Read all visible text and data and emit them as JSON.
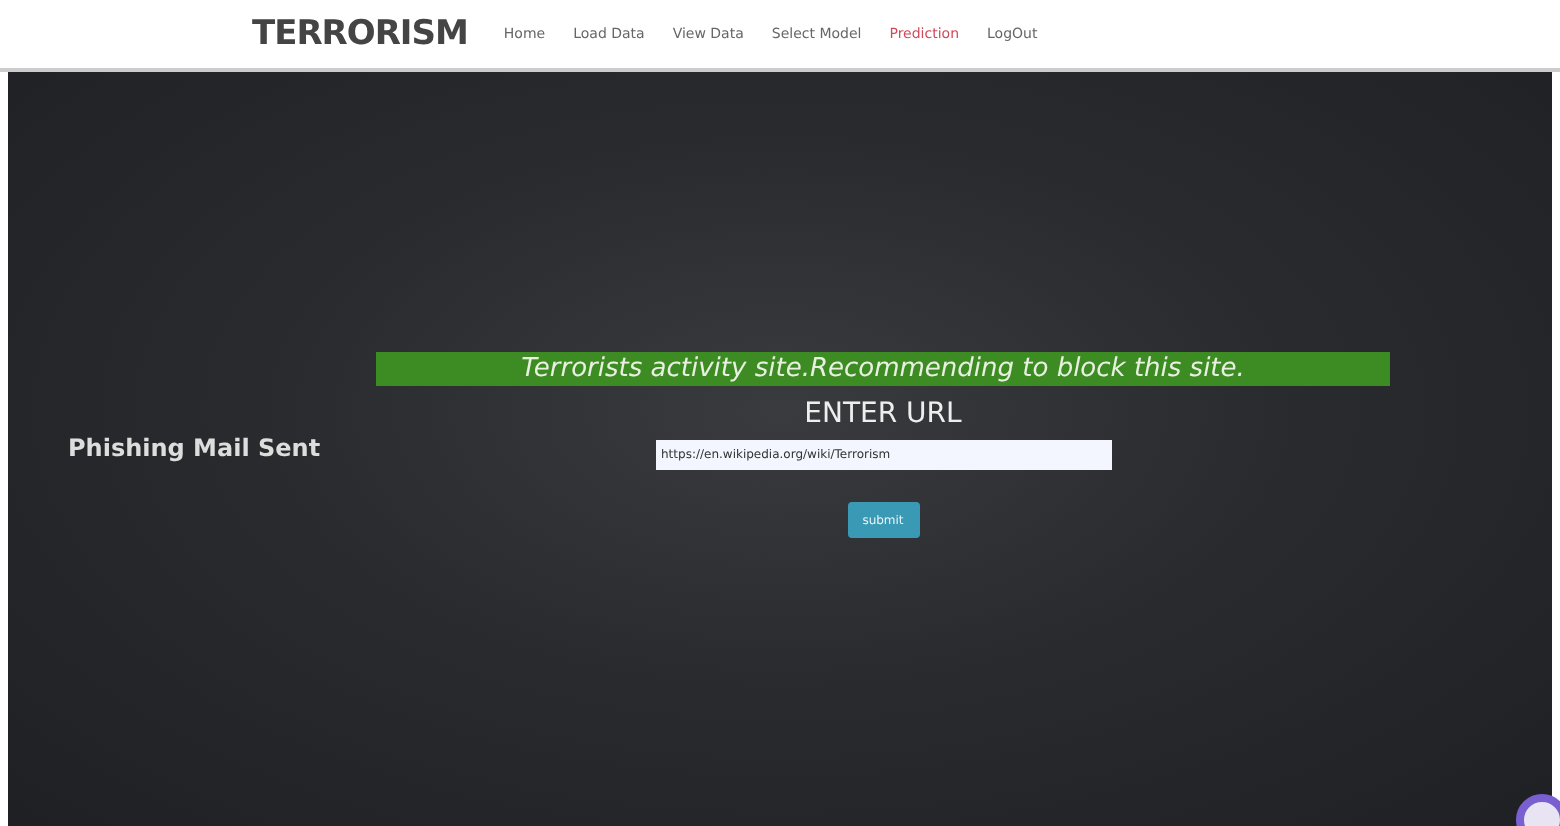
{
  "header": {
    "brand": "TERRORISM",
    "nav": [
      {
        "label": "Home",
        "selected": false
      },
      {
        "label": "Load Data",
        "selected": false
      },
      {
        "label": "View Data",
        "selected": false
      },
      {
        "label": "Select Model",
        "selected": false
      },
      {
        "label": "Prediction",
        "selected": true
      },
      {
        "label": "LogOut",
        "selected": false
      }
    ]
  },
  "main": {
    "status": "Phishing Mail Sent",
    "alert": "Terrorists activity site.Recommending to block this site.",
    "heading": "ENTER URL",
    "url_field": {
      "value": "https://en.wikipedia.org/wiki/Terrorism"
    },
    "submit": "submit"
  }
}
